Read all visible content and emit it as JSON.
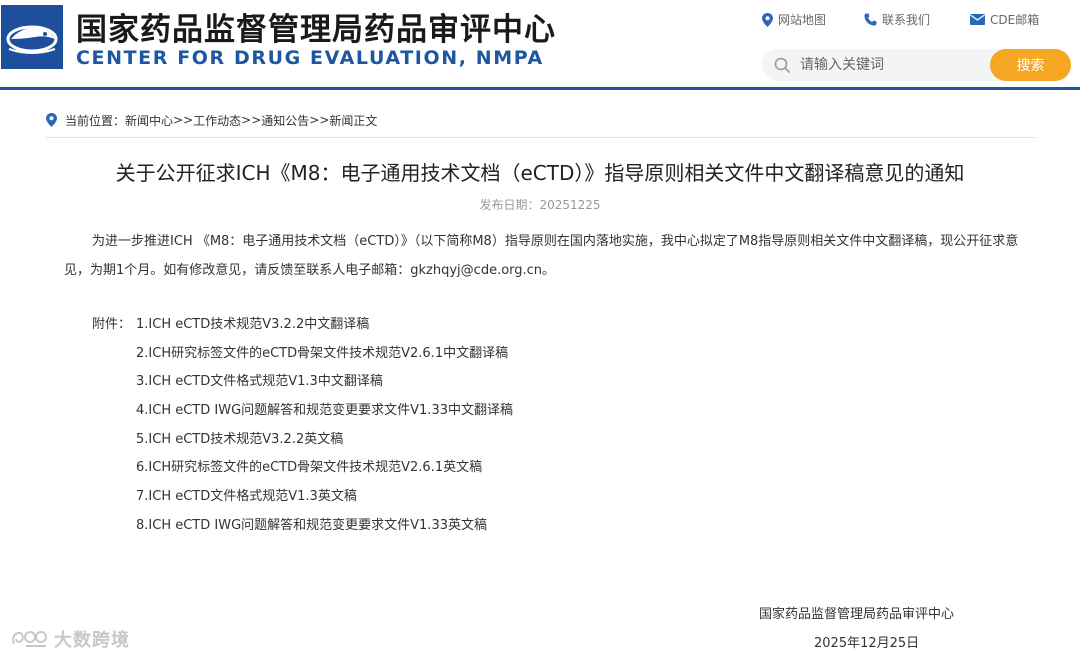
{
  "header": {
    "title_cn": "国家药品监督管理局药品审评中心",
    "title_en": "CENTER FOR DRUG EVALUATION, NMPA",
    "links": {
      "sitemap": "网站地图",
      "contact": "联系我们",
      "mail": "CDE邮箱"
    },
    "search": {
      "placeholder": "请输入关键词",
      "button": "搜索"
    },
    "accent_color": "#1e56a0",
    "button_color": "#f5a623"
  },
  "breadcrumb": {
    "prefix": "当前位置：",
    "items": [
      "新闻中心",
      "工作动态",
      "通知公告",
      "新闻正文"
    ],
    "separator": ">>"
  },
  "article": {
    "title": "关于公开征求ICH《M8：电子通用技术文档（eCTD）》指导原则相关文件中文翻译稿意见的通知",
    "date_label": "发布日期：",
    "date": "20251225",
    "paragraph": "为进一步推进ICH 《M8：电子通用技术文档（eCTD）》（以下简称M8）指导原则在国内落地实施，我中心拟定了M8指导原则相关文件中文翻译稿，现公开征求意见，为期1个月。如有修改意见，请反馈至联系人电子邮箱：gkzhqyj@cde.org.cn。",
    "attachments_label": "附件：",
    "attachments": [
      "1.ICH eCTD技术规范V3.2.2中文翻译稿",
      "2.ICH研究标签文件的eCTD骨架文件技术规范V2.6.1中文翻译稿",
      "3.ICH eCTD文件格式规范V1.3中文翻译稿",
      "4.ICH eCTD IWG问题解答和规范变更要求文件V1.33中文翻译稿",
      "5.ICH eCTD技术规范V3.2.2英文稿",
      "6.ICH研究标签文件的eCTD骨架文件技术规范V2.6.1英文稿",
      "7.ICH eCTD文件格式规范V1.3英文稿",
      "8.ICH eCTD IWG问题解答和规范变更要求文件V1.33英文稿"
    ],
    "signature_org": "国家药品监督管理局药品审评中心",
    "signature_date": "2025年12月25日"
  },
  "watermark": {
    "text": "大数跨境"
  },
  "icons": [
    "logo-icon",
    "location-pin-icon",
    "phone-icon",
    "mail-icon",
    "search-icon",
    "breadcrumb-pin-icon",
    "watermark-logo-icon"
  ]
}
